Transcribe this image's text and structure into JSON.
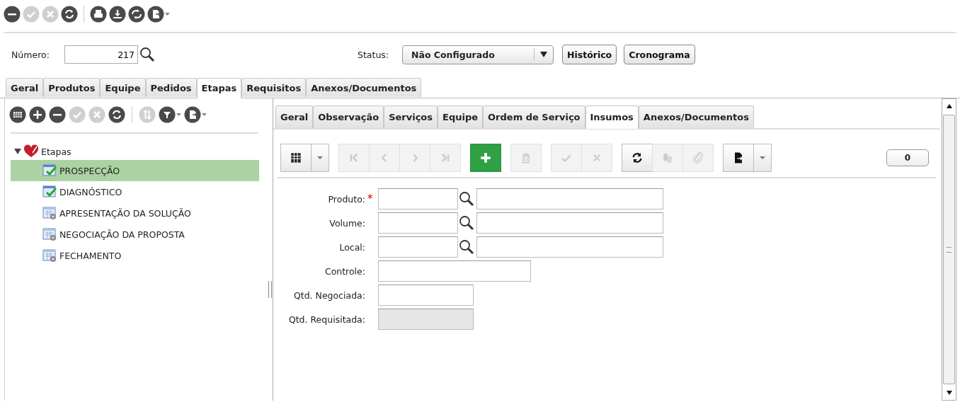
{
  "toolbar": {
    "groups": [
      [
        {
          "kind": "minus",
          "disabled": false
        },
        {
          "kind": "check",
          "disabled": true
        },
        {
          "kind": "close",
          "disabled": true
        },
        {
          "kind": "refresh",
          "disabled": false
        }
      ],
      [
        {
          "kind": "print",
          "disabled": false
        },
        {
          "kind": "download",
          "disabled": false
        },
        {
          "kind": "sync",
          "disabled": false
        },
        {
          "kind": "export",
          "disabled": false,
          "caret": true
        }
      ]
    ]
  },
  "header": {
    "number_label": "Número:",
    "number_value": "217",
    "status_label": "Status:",
    "status_value": "Não Configurado",
    "buttons": [
      "Histórico",
      "Cronograma"
    ]
  },
  "tabs": [
    {
      "label": "Geral",
      "selected": false
    },
    {
      "label": "Produtos",
      "selected": false
    },
    {
      "label": "Equipe",
      "selected": false
    },
    {
      "label": "Pedidos",
      "selected": false
    },
    {
      "label": "Etapas",
      "selected": true
    },
    {
      "label": "Requisitos",
      "selected": false
    },
    {
      "label": "Anexos/Documentos",
      "selected": false
    }
  ],
  "left_toolbar": {
    "groups": [
      [
        {
          "kind": "grid",
          "disabled": false
        },
        {
          "kind": "plus",
          "disabled": false
        },
        {
          "kind": "minus",
          "disabled": false
        },
        {
          "kind": "check",
          "disabled": true
        },
        {
          "kind": "close",
          "disabled": true
        },
        {
          "kind": "refresh",
          "disabled": false
        }
      ],
      [
        {
          "kind": "sort",
          "disabled": true
        },
        {
          "kind": "filter",
          "disabled": false,
          "caret": true
        },
        {
          "kind": "export",
          "disabled": false,
          "caret": true
        }
      ]
    ]
  },
  "tree": {
    "label": "Etapas",
    "expanded": true,
    "children": [
      {
        "label": "PROSPECÇÃO",
        "kind": "done",
        "selected": true
      },
      {
        "label": "DIAGNÓSTICO",
        "kind": "done",
        "selected": false
      },
      {
        "label": "APRESENTAÇÃO DA SOLUÇÃO",
        "kind": "pending",
        "selected": false
      },
      {
        "label": "NEGOCIAÇÃO DA PROPOSTA",
        "kind": "pending",
        "selected": false
      },
      {
        "label": "FECHAMENTO",
        "kind": "pending",
        "selected": false
      }
    ]
  },
  "subtabs": [
    {
      "label": "Geral",
      "selected": false
    },
    {
      "label": "Observação",
      "selected": false
    },
    {
      "label": "Serviços",
      "selected": false
    },
    {
      "label": "Equipe",
      "selected": false
    },
    {
      "label": "Ordem de Serviço",
      "selected": false
    },
    {
      "label": "Insumos",
      "selected": true
    },
    {
      "label": "Anexos/Documentos",
      "selected": false
    }
  ],
  "grid_toolbar": {
    "groups": [
      [
        {
          "kind": "table",
          "disabled": false
        },
        {
          "kind": "caret",
          "disabled": false
        }
      ],
      [
        {
          "kind": "first",
          "disabled": true
        },
        {
          "kind": "prev",
          "disabled": true
        },
        {
          "kind": "next",
          "disabled": true
        },
        {
          "kind": "last",
          "disabled": true
        }
      ],
      [
        {
          "kind": "add",
          "disabled": false
        }
      ],
      [
        {
          "kind": "delete",
          "disabled": true
        }
      ],
      [
        {
          "kind": "confirm",
          "disabled": true
        },
        {
          "kind": "cancel",
          "disabled": true
        }
      ],
      [
        {
          "kind": "refresh",
          "disabled": false
        },
        {
          "kind": "copy",
          "disabled": true
        },
        {
          "kind": "attach",
          "disabled": true
        }
      ],
      [
        {
          "kind": "export",
          "disabled": false
        },
        {
          "kind": "caret",
          "disabled": false
        }
      ]
    ],
    "count": "0"
  },
  "form": [
    {
      "label": "Produto:",
      "required_mark": "*",
      "kind": "lookup",
      "disabled": false
    },
    {
      "label": "Volume:",
      "kind": "lookup",
      "disabled": false
    },
    {
      "label": "Local:",
      "kind": "lookup",
      "disabled": false
    },
    {
      "label": "Controle:",
      "kind": "text",
      "disabled": false
    },
    {
      "label": "Qtd. Negociada:",
      "kind": "number",
      "disabled": false
    },
    {
      "label": "Qtd. Requisitada:",
      "kind": "number",
      "disabled": true
    }
  ]
}
